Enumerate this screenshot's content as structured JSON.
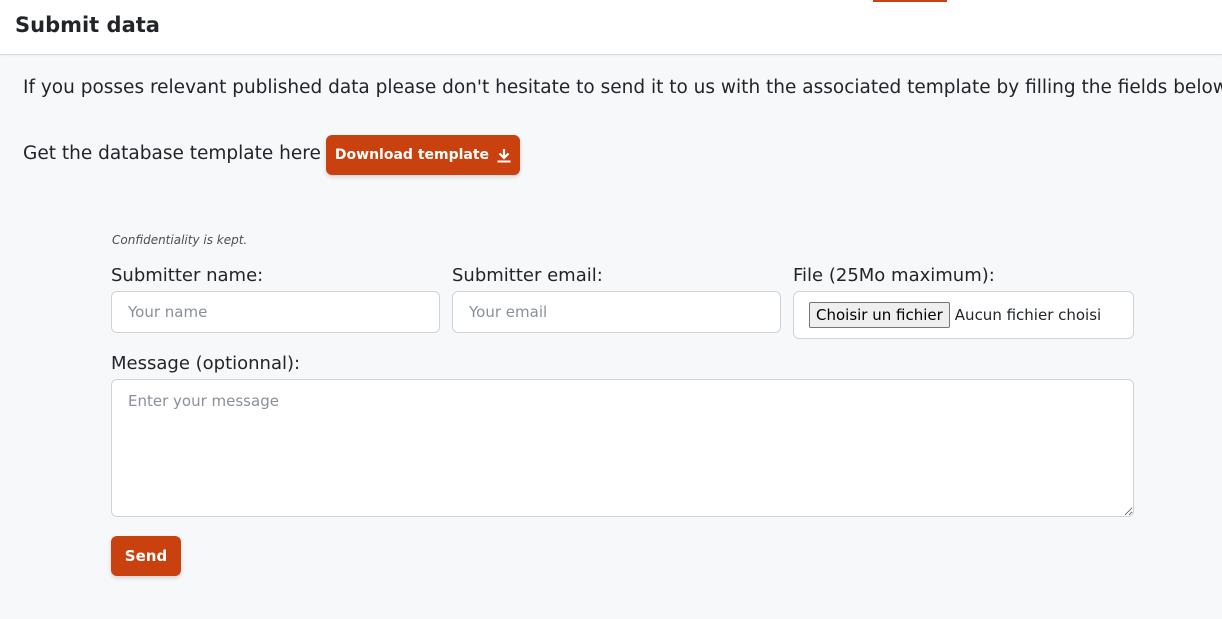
{
  "page": {
    "title": "Submit data",
    "intro": "If you posses relevant published data please don't hesitate to send it to us with the associated template by filling the fields below."
  },
  "template": {
    "label": "Get the database template here :",
    "button_label": "Download template",
    "button_icon": "download-icon"
  },
  "form": {
    "confidentiality_note": "Confidentiality is kept.",
    "name": {
      "label": "Submitter name:",
      "placeholder": "Your name"
    },
    "email": {
      "label": "Submitter email:",
      "placeholder": "Your email"
    },
    "file": {
      "label": "File (25Mo maximum):",
      "button_label": "Choisir un fichier",
      "status": "Aucun fichier choisi"
    },
    "message": {
      "label": "Message (optionnal):",
      "placeholder": "Enter your message"
    },
    "send_label": "Send"
  },
  "colors": {
    "accent": "#c8410e",
    "background": "#f7f8fa",
    "header_background": "#ffffff"
  }
}
